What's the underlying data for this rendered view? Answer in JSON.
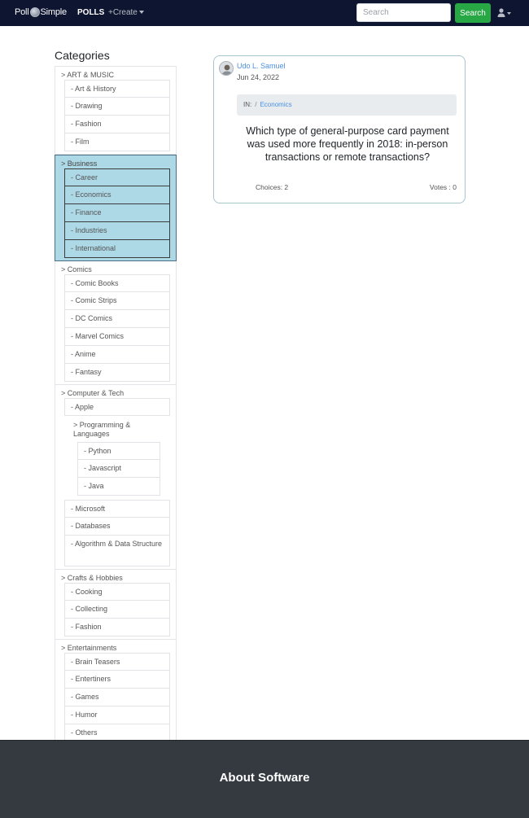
{
  "navbar": {
    "brand_left": "Poll",
    "brand_right": "Simple",
    "polls_label": "POLLS",
    "create_label": "+Create",
    "search_placeholder": "Search",
    "search_button": "Search"
  },
  "sidebar": {
    "title": "Categories",
    "groups": [
      {
        "label": "> ART & MUSIC",
        "items": [
          "- Art & History",
          "- Drawing",
          "- Fashion",
          "- Film"
        ]
      },
      {
        "label": "> Business",
        "items": [
          "- Career",
          "- Economics",
          "- Finance",
          "- Industries",
          "- International"
        ]
      },
      {
        "label": "> Comics",
        "items": [
          "- Comic Books",
          "- Comic Strips",
          "- DC Comics",
          "- Marvel Comics",
          "- Anime",
          "- Fantasy"
        ]
      },
      {
        "label": "> Computer & Tech",
        "items_before": [
          "- Apple"
        ],
        "nested_label": "> Programming & Languages",
        "nested_items": [
          "- Python",
          "- Javascript",
          "- Java"
        ],
        "items_after": [
          "- Microsoft",
          "- Databases",
          "- Algorithm & Data Structure"
        ]
      },
      {
        "label": "> Crafts & Hobbies",
        "items": [
          "- Cooking",
          "- Collecting",
          "- Fashion"
        ]
      },
      {
        "label": "> Entertainments",
        "items": [
          "- Brain Teasers",
          "- Entertiners",
          "- Games",
          "- Humor",
          "- Others"
        ]
      }
    ]
  },
  "poll": {
    "author": "Udo L. Samuel",
    "date": "Jun 24, 2022",
    "crumb_prefix": "IN:",
    "crumb_sep": "/",
    "category": "Economics",
    "question": "Which type of general-purpose card payment was used more frequently in 2018: in-person transactions or remote transactions?",
    "choices": "Choices: 2",
    "votes": "Votes : 0"
  },
  "footer": {
    "title": "About Software"
  }
}
